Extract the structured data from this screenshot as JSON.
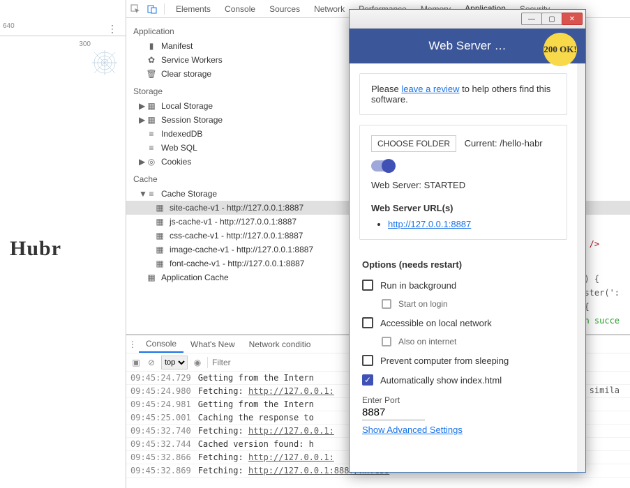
{
  "ruler": {
    "value": "640",
    "subtick": "300"
  },
  "logo": "Hubr",
  "devtools": {
    "tabs": [
      "Elements",
      "Console",
      "Sources",
      "Network",
      "Performance",
      "Memory",
      "Application",
      "Security"
    ],
    "active_tab": "Application",
    "application": {
      "section_app": "Application",
      "manifest": "Manifest",
      "service_workers": "Service Workers",
      "clear_storage": "Clear storage",
      "section_storage": "Storage",
      "local_storage": "Local Storage",
      "session_storage": "Session Storage",
      "indexeddb": "IndexedDB",
      "websql": "Web SQL",
      "cookies": "Cookies",
      "section_cache": "Cache",
      "cache_storage": "Cache Storage",
      "caches": [
        "site-cache-v1 - http://127.0.0.1:8887",
        "js-cache-v1 - http://127.0.0.1:8887",
        "css-cache-v1 - http://127.0.0.1:8887",
        "image-cache-v1 - http://127.0.0.1:8887",
        "font-cache-v1 - http://127.0.0.1:8887"
      ],
      "app_cache": "Application Cache"
    },
    "console_tabs": [
      "Console",
      "What's New",
      "Network conditio"
    ],
    "console_toolbar": {
      "context": "top",
      "filter_placeholder": "Filter"
    },
    "log": [
      {
        "ts": "09:45:24.729",
        "verb": "",
        "msg": "Getting from the Intern"
      },
      {
        "ts": "09:45:24.980",
        "verb": "Fetching:",
        "url": "http://127.0.0.1:"
      },
      {
        "ts": "09:45:24.981",
        "verb": "",
        "msg": "Getting from the Intern"
      },
      {
        "ts": "09:45:25.001",
        "verb": "",
        "msg": "Caching the response to"
      },
      {
        "ts": "09:45:32.740",
        "verb": "Fetching:",
        "url": "http://127.0.0.1:"
      },
      {
        "ts": "09:45:32.744",
        "verb": "",
        "msg": "Cached version found: h"
      },
      {
        "ts": "09:45:32.866",
        "verb": "Fetching:",
        "url": "http://127.0.0.1:"
      },
      {
        "ts": "09:45:32.869",
        "verb": "Fetching:",
        "url": "http://127.0.0.1:8887/hh.css"
      }
    ]
  },
  "code_peek": {
    "l1": "s\" />",
    "l2": "or) {",
    "l3": "gister(':",
    "l4": ") {",
    "l5": "ion succe",
    "l6": "up simila"
  },
  "popup": {
    "title": "Web Server …",
    "badge": "200\nOK!",
    "review_pre": "Please ",
    "review_link": "leave a review",
    "review_post": " to help others find this software.",
    "choose": "CHOOSE FOLDER",
    "current": "Current: /hello-habr",
    "status": "Web Server: STARTED",
    "urls_heading": "Web Server URL(s)",
    "url": "http://127.0.0.1:8887",
    "options_heading": "Options (needs restart)",
    "opts": {
      "run_bg": "Run in background",
      "start_login": "Start on login",
      "lan": "Accessible on local network",
      "internet": "Also on internet",
      "nosleep": "Prevent computer from sleeping",
      "index": "Automatically show index.html"
    },
    "port_label": "Enter Port",
    "port_value": "8887",
    "advanced": "Show Advanced Settings"
  }
}
